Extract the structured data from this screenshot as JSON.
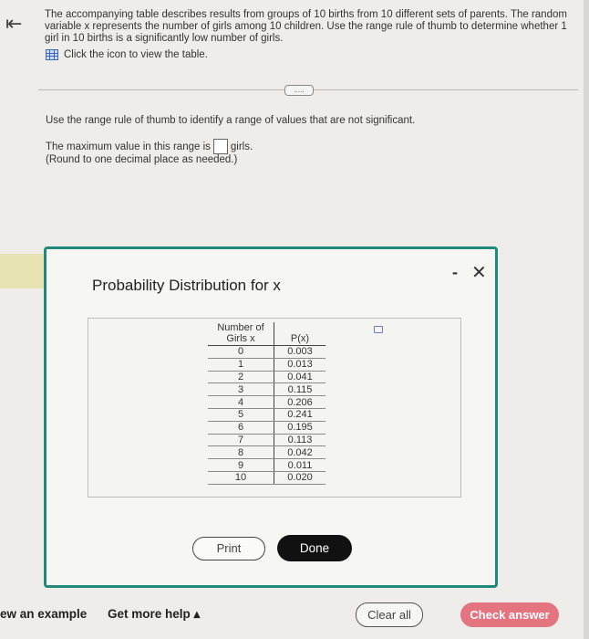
{
  "header": {
    "back_icon": "back-arrow-icon",
    "intro_text": "The accompanying table describes results from groups of 10 births from 10 different sets of parents. The random variable x represents the number of girls among 10 children. Use the range rule of thumb to determine whether 1 girl in 10 births is a significantly low number of girls.",
    "view_table_label": "Click the icon to view the table.",
    "more_label": "....."
  },
  "question": {
    "prompt": "Use the range rule of thumb to identify a range of values that are not significant.",
    "answer_prefix": "The maximum value in this range is",
    "answer_value": "",
    "answer_suffix": "girls.",
    "rounding_note": "(Round to one decimal place as needed.)"
  },
  "dialog": {
    "title": "Probability Distribution for x",
    "minimize_label": "-",
    "close_label": "✕",
    "table": {
      "header_x": [
        "Number of",
        "Girls x"
      ],
      "header_p": "P(x)",
      "rows": [
        {
          "x": "0",
          "p": "0.003"
        },
        {
          "x": "1",
          "p": "0.013"
        },
        {
          "x": "2",
          "p": "0.041"
        },
        {
          "x": "3",
          "p": "0.115"
        },
        {
          "x": "4",
          "p": "0.206"
        },
        {
          "x": "5",
          "p": "0.241"
        },
        {
          "x": "6",
          "p": "0.195"
        },
        {
          "x": "7",
          "p": "0.113"
        },
        {
          "x": "8",
          "p": "0.042"
        },
        {
          "x": "9",
          "p": "0.011"
        },
        {
          "x": "10",
          "p": "0.020"
        }
      ]
    },
    "print_label": "Print",
    "done_label": "Done"
  },
  "footer": {
    "example_label": "ew an example",
    "help_label": "Get more help ▴",
    "clear_label": "Clear all",
    "check_label": "Check answer"
  },
  "colors": {
    "dialog_border": "#1f8a7c",
    "check_button": "#e47480",
    "done_button": "#111111"
  }
}
